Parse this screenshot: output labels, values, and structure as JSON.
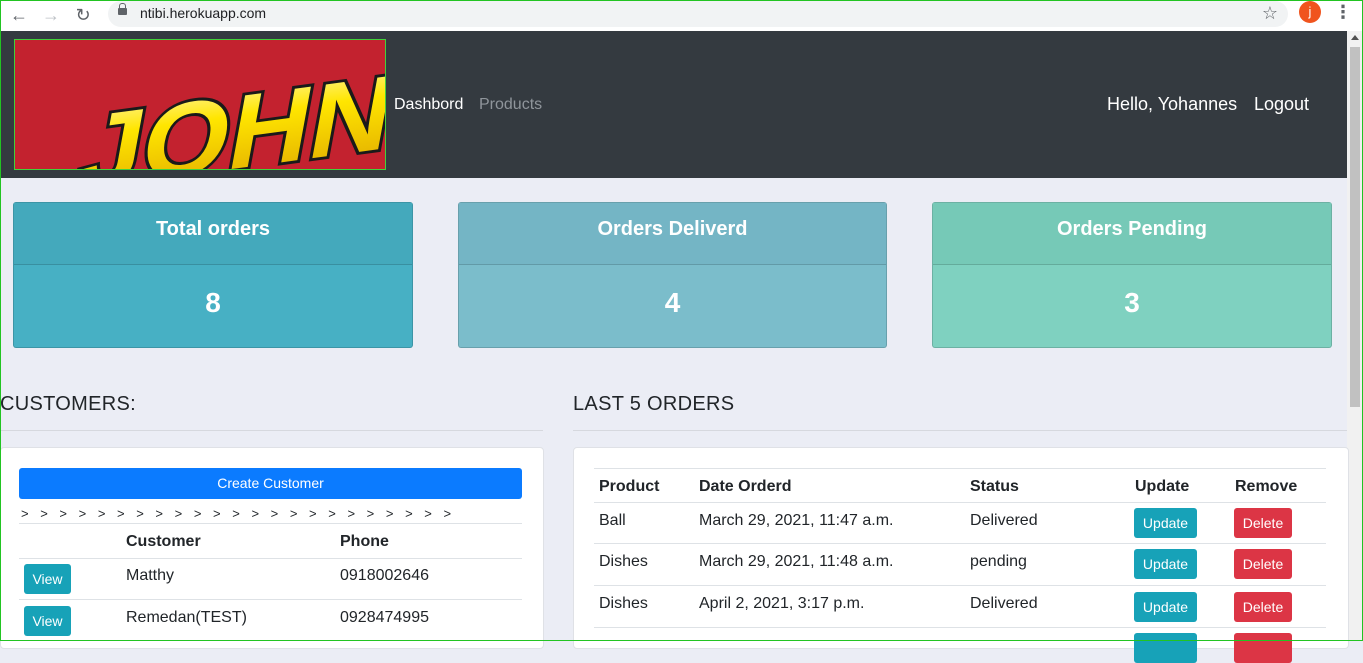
{
  "browser": {
    "url": "ntibi.herokuapp.com",
    "avatar_letter": "j"
  },
  "navbar": {
    "logo_text": "JOHNNY",
    "links": [
      {
        "label": "Dashbord"
      },
      {
        "label": "Products"
      }
    ],
    "greeting": "Hello, Yohannes",
    "logout": "Logout"
  },
  "stats": [
    {
      "label": "Total orders",
      "value": "8",
      "color": "#47b0c4"
    },
    {
      "label": "Orders Deliverd",
      "value": "4",
      "color": "#7bbdcb"
    },
    {
      "label": "Orders Pending",
      "value": "3",
      "color": "#7fd1c0"
    }
  ],
  "customers": {
    "title": "CUSTOMERS:",
    "create_button": "Create Customer",
    "arrows": "> > > > > > > > > > > > > > > > > > > > > > >",
    "columns": [
      "",
      "Customer",
      "Phone"
    ],
    "rows": [
      {
        "action": "View",
        "name": "Matthy",
        "phone": "0918002646"
      },
      {
        "action": "View",
        "name": "Remedan(TEST)",
        "phone": "0928474995"
      }
    ]
  },
  "orders": {
    "title": "LAST 5 ORDERS",
    "columns": [
      "Product",
      "Date Orderd",
      "Status",
      "Update",
      "Remove"
    ],
    "rows": [
      {
        "product": "Ball",
        "date": "March 29, 2021, 11:47 a.m.",
        "status": "Delivered",
        "update": "Update",
        "remove": "Delete"
      },
      {
        "product": "Dishes",
        "date": "March 29, 2021, 11:48 a.m.",
        "status": "pending",
        "update": "Update",
        "remove": "Delete"
      },
      {
        "product": "Dishes",
        "date": "April 2, 2021, 3:17 p.m.",
        "status": "Delivered",
        "update": "Update",
        "remove": "Delete"
      }
    ]
  },
  "colors": {
    "navbar": "#343a40",
    "primary": "#0b7bff",
    "info": "#17a2b8",
    "danger": "#dc3545"
  }
}
